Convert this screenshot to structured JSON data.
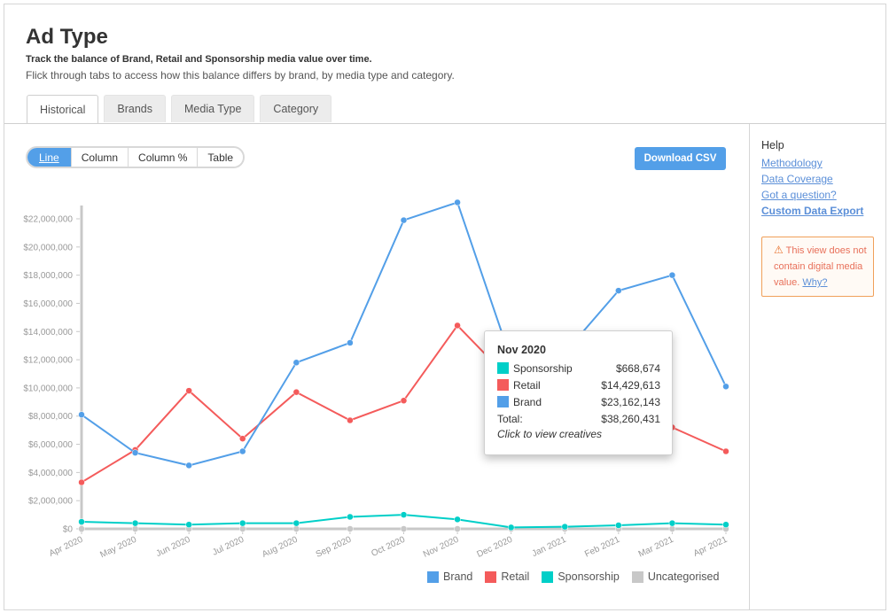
{
  "header": {
    "title": "Ad Type",
    "subtitle": "Track the balance of Brand, Retail and Sponsorship media value over time.",
    "description": "Flick through tabs to access how this balance differs by brand, by media type and category."
  },
  "tabs": [
    {
      "label": "Historical",
      "active": true
    },
    {
      "label": "Brands",
      "active": false
    },
    {
      "label": "Media Type",
      "active": false
    },
    {
      "label": "Category",
      "active": false
    }
  ],
  "view_toggle": [
    {
      "label": "Line",
      "active": true
    },
    {
      "label": "Column",
      "active": false
    },
    {
      "label": "Column %",
      "active": false
    },
    {
      "label": "Table",
      "active": false
    }
  ],
  "download_button": "Download CSV",
  "help": {
    "title": "Help",
    "links": [
      "Methodology",
      "Data Coverage",
      "Got a question?",
      "Custom Data Export"
    ]
  },
  "warning": {
    "icon": "warning-triangle-icon",
    "text": "This view does not contain digital media value.",
    "link": "Why?"
  },
  "tooltip": {
    "title": "Nov 2020",
    "rows": [
      {
        "label": "Sponsorship",
        "value": "$668,674",
        "color": "#00cfc8"
      },
      {
        "label": "Retail",
        "value": "$14,429,613",
        "color": "#f45b5b"
      },
      {
        "label": "Brand",
        "value": "$23,162,143",
        "color": "#539fe8"
      }
    ],
    "total_label": "Total:",
    "total_value": "$38,260,431",
    "footer": "Click to view creatives"
  },
  "chart_data": {
    "type": "line",
    "title": "",
    "xlabel": "",
    "ylabel": "",
    "x": [
      "Apr 2020",
      "May 2020",
      "Jun 2020",
      "Jul 2020",
      "Aug 2020",
      "Sep 2020",
      "Oct 2020",
      "Nov 2020",
      "Dec 2020",
      "Jan 2021",
      "Feb 2021",
      "Mar 2021",
      "Apr 2021"
    ],
    "ylim": [
      0,
      22000000
    ],
    "yticks": [
      0,
      2000000,
      4000000,
      6000000,
      8000000,
      10000000,
      12000000,
      14000000,
      16000000,
      18000000,
      20000000,
      22000000
    ],
    "ytick_labels": [
      "$0",
      "$2,000,000",
      "$4,000,000",
      "$6,000,000",
      "$8,000,000",
      "$10,000,000",
      "$12,000,000",
      "$14,000,000",
      "$16,000,000",
      "$18,000,000",
      "$20,000,000",
      "$22,000,000"
    ],
    "grid": false,
    "legend_position": "bottom-right",
    "series": [
      {
        "name": "Brand",
        "color": "#539fe8",
        "values": [
          8100000,
          5400000,
          4500000,
          5500000,
          11800000,
          13200000,
          21900000,
          23162143,
          12000000,
          12500000,
          16900000,
          18000000,
          10100000
        ]
      },
      {
        "name": "Retail",
        "color": "#f45b5b",
        "values": [
          3300000,
          5600000,
          9800000,
          6400000,
          9700000,
          7700000,
          9100000,
          14429613,
          10500000,
          9000000,
          8200000,
          7200000,
          5500000
        ]
      },
      {
        "name": "Sponsorship",
        "color": "#00cfc8",
        "values": [
          500000,
          400000,
          300000,
          400000,
          400000,
          850000,
          1000000,
          668674,
          100000,
          150000,
          250000,
          400000,
          300000
        ]
      },
      {
        "name": "Uncategorised",
        "color": "#c8c8c8",
        "values": [
          0,
          0,
          0,
          0,
          0,
          0,
          0,
          0,
          0,
          0,
          0,
          0,
          0
        ]
      }
    ]
  }
}
